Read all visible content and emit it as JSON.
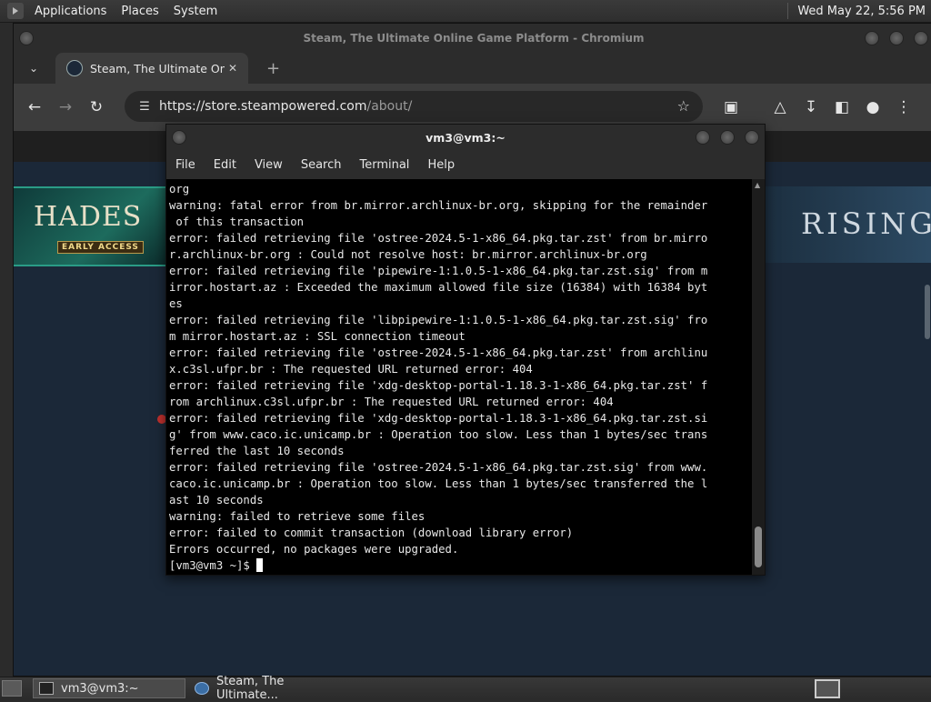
{
  "top_panel": {
    "menus": [
      "Applications",
      "Places",
      "System"
    ],
    "clock": "Wed May 22,  5:56 PM"
  },
  "browser": {
    "window_title": "Steam, The Ultimate Online Game Platform - Chromium",
    "tab": {
      "title": "Steam, The Ultimate Online"
    },
    "url_host": "https://store.steampowered.com",
    "url_path": "/about/",
    "page": {
      "banner_left_title": "HADES",
      "banner_left_subtitle": "EARLY ACCESS",
      "banner_right_title": "RISING"
    }
  },
  "terminal": {
    "title": "vm3@vm3:~",
    "menus": [
      "File",
      "Edit",
      "View",
      "Search",
      "Terminal",
      "Help"
    ],
    "lines": [
      "org",
      "warning: fatal error from br.mirror.archlinux-br.org, skipping for the remainder",
      " of this transaction",
      "error: failed retrieving file 'ostree-2024.5-1-x86_64.pkg.tar.zst' from br.mirro",
      "r.archlinux-br.org : Could not resolve host: br.mirror.archlinux-br.org",
      "error: failed retrieving file 'pipewire-1:1.0.5-1-x86_64.pkg.tar.zst.sig' from m",
      "irror.hostart.az : Exceeded the maximum allowed file size (16384) with 16384 byt",
      "es",
      "error: failed retrieving file 'libpipewire-1:1.0.5-1-x86_64.pkg.tar.zst.sig' fro",
      "m mirror.hostart.az : SSL connection timeout",
      "error: failed retrieving file 'ostree-2024.5-1-x86_64.pkg.tar.zst' from archlinu",
      "x.c3sl.ufpr.br : The requested URL returned error: 404",
      "error: failed retrieving file 'xdg-desktop-portal-1.18.3-1-x86_64.pkg.tar.zst' f",
      "rom archlinux.c3sl.ufpr.br : The requested URL returned error: 404",
      "error: failed retrieving file 'xdg-desktop-portal-1.18.3-1-x86_64.pkg.tar.zst.si",
      "g' from www.caco.ic.unicamp.br : Operation too slow. Less than 1 bytes/sec trans",
      "ferred the last 10 seconds",
      "error: failed retrieving file 'ostree-2024.5-1-x86_64.pkg.tar.zst.sig' from www.",
      "caco.ic.unicamp.br : Operation too slow. Less than 1 bytes/sec transferred the l",
      "ast 10 seconds",
      "warning: failed to retrieve some files",
      "error: failed to commit transaction (download library error)",
      "Errors occurred, no packages were upgraded."
    ],
    "prompt": "[vm3@vm3 ~]$ "
  },
  "taskbar": {
    "items": [
      {
        "label": "vm3@vm3:~"
      },
      {
        "label": "Steam, The Ultimate..."
      }
    ]
  },
  "icons": [
    "gnome-foot-icon",
    "chevron-down-icon",
    "steam-favicon-icon",
    "close-icon",
    "plus-icon",
    "back-icon",
    "forward-icon",
    "reload-icon",
    "tune-icon",
    "star-icon",
    "extensions-icon",
    "labs-icon",
    "download-icon",
    "side-panel-icon",
    "profile-icon",
    "more-vert-icon",
    "terminal-icon",
    "chromium-icon"
  ]
}
